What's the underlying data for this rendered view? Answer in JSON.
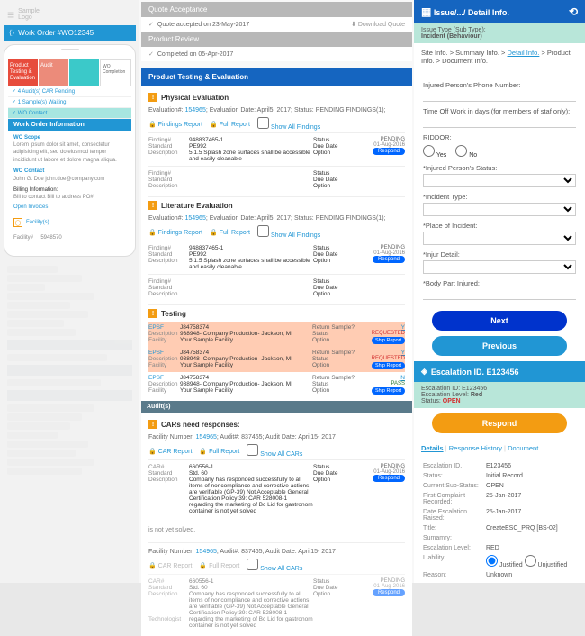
{
  "left": {
    "logo": "Sample",
    "logo_sub": "Logo",
    "wo_header": "Work Order #WO12345",
    "tabs": [
      {
        "label": "Product Testing & Evaluation"
      },
      {
        "label": "Audit"
      },
      {
        "label": ""
      },
      {
        "label": "WO Completion"
      }
    ],
    "status": [
      "4 Audit(s) CAR Pending",
      "1 Sample(s) Waiting",
      "WO Contact"
    ],
    "section_woi": "Work Order Information",
    "wo_scope_label": "WO Scope",
    "wo_scope_text": "Lorem ipsum dolor sit amet, consectetur adipisicing elit, sed do eiusmod tempor incididunt ut labore et dolore magna aliqua.",
    "wo_contact_label": "WO Contact",
    "wo_contact_text": "John G. Doe\njohn.doe@company.com",
    "billing_label": "Billing Information:",
    "billing_text": "Bill to contact\nBill to address\nPO#",
    "open_invoices": "Open Invoices",
    "facility_label": "Facility(s)",
    "facility_num": "5948570"
  },
  "mid": {
    "qa_header": "Quote Acceptance",
    "qa_sub": "Quote accepted on 23-May-2017",
    "qa_download": "Download Quote",
    "pr_header": "Product Review",
    "pr_sub": "Completed on 05-Apr-2017",
    "pte_header": "Product Testing & Evaluation",
    "phys_eval": "Physical Evaluation",
    "eval_line": "Evaluation#:",
    "eval_num": "154965",
    "eval_date_lbl": "Evaluation Date:",
    "eval_date": "April5, 2017;",
    "eval_status_lbl": "Status:",
    "eval_status": "PENDING FINDINGS(1);",
    "findings_report": "Findings Report",
    "full_report": "Full Report",
    "show_all": "Show All Findings",
    "findings": [
      {
        "num": "948837465-1",
        "std": "PE992",
        "desc": "5.1.5 Splash zone surfaces shall be accessible and easily cleanable",
        "status": "PENDING",
        "due": "01-Aug-2016"
      },
      {
        "num": "",
        "std": "",
        "desc": "",
        "status": "",
        "due": ""
      }
    ],
    "lit_eval": "Literature Evaluation",
    "testing_hdr": "Testing",
    "tests": [
      {
        "epsf": "J84758374",
        "desc": "938948- Company Production- Jackson, MI",
        "fac": "Your Sample Facility",
        "rs": "Return Sample?",
        "y": "Y",
        "opt": "REQUESTED",
        "ship": "Ship Report",
        "orange": true
      },
      {
        "epsf": "J84758374",
        "desc": "938948- Company Production- Jackson, MI",
        "fac": "Your Sample Facility",
        "rs": "Return Sample?",
        "y": "Y",
        "opt": "REQUESTED",
        "ship": "Ship Report",
        "orange": true
      },
      {
        "epsf": "J84758374",
        "desc": "938948- Company Production- Jackson, MI",
        "fac": "Your Sample Facility",
        "rs": "Return Sample?",
        "y": "N",
        "opt": "PASS",
        "ship": "Ship Report",
        "orange": false
      }
    ],
    "audit_hdr": "Audit(s)",
    "car_need": "CARs need responses:",
    "audit_line": "Facility Number:",
    "audit_fnum": "154965",
    "audit_num_lbl": "Audit#:",
    "audit_num": "837465;",
    "audit_date_lbl": "Audit Date:",
    "audit_date": "April15- 2017",
    "car_report": "CAR Report",
    "show_cars": "Show All CARs",
    "car": {
      "num": "660556-1",
      "std": "Std. 60",
      "desc": "Company has responded successfully to all items of noncompliance and corrective actions are verifiable (GP-39) Not Acceptable General Certification Policy 39: CAR 528008-1 regarding the marketing of Bc Lid for gastronom container is not yet solved",
      "status": "PENDING",
      "due": "01-Aug-2016"
    },
    "not_solved": "is not yet solved.",
    "f_labels": {
      "finding": "Finding#",
      "standard": "Standard",
      "desc": "Description",
      "status": "Status",
      "due": "Due Date",
      "option": "Option",
      "epsf": "EPSF",
      "facility": "Facility",
      "car": "CAR#",
      "tech": "Technologist"
    },
    "respond": "Respond"
  },
  "right": {
    "issue_header": "Issue/.../ Detail Info.",
    "type_label": "Issue Type (Sub Type):",
    "type_value": "Incident (Behaviour)",
    "breadcrumb": [
      "Site Info.",
      "Summary Info.",
      "Detail Info.",
      "Product Info.",
      "Document Info."
    ],
    "bc_active": 2,
    "phone_label": "Injured Person's Phone Number:",
    "timeoff_label": "Time Off Work in days (for members of staf only):",
    "riddor_label": "RIDDOR:",
    "yes": "Yes",
    "no": "No",
    "ip_status": "*Injured Person's Status:",
    "inc_type": "*Incident Type:",
    "place": "*Place of Incident:",
    "injur": "*Injur Detail:",
    "body": "*Body Part Injured:",
    "next": "Next",
    "previous": "Previous",
    "esc_header": "Escalation ID. E123456",
    "esc_id_lbl": "Escalation ID:",
    "esc_id": "E123456",
    "esc_lvl_lbl": "Escalation Level:",
    "esc_lvl": "Red",
    "esc_status_lbl": "Status:",
    "esc_status": "OPEN",
    "respond": "Respond",
    "tabs": [
      "Details",
      "Response History",
      "Document"
    ],
    "details": [
      {
        "l": "Escalation ID.",
        "v": "E123456"
      },
      {
        "l": "Status:",
        "v": "Initial Record"
      },
      {
        "l": "Current Sub-Status:",
        "v": "OPEN"
      },
      {
        "l": "First Complaint Recorded:",
        "v": "25-Jan-2017"
      },
      {
        "l": "Date Escalation Raised:",
        "v": "25-Jan-2017"
      },
      {
        "l": "Title:",
        "v": "CreateESC_PRQ [BS-02]"
      },
      {
        "l": "Sumamry:",
        "v": ""
      },
      {
        "l": "Escalation Level:",
        "v": "RED"
      },
      {
        "l": "Liability:",
        "v": ""
      },
      {
        "l": "Reason:",
        "v": "Unknown"
      }
    ],
    "justified": "Justified",
    "unjustified": "Unjustified"
  }
}
